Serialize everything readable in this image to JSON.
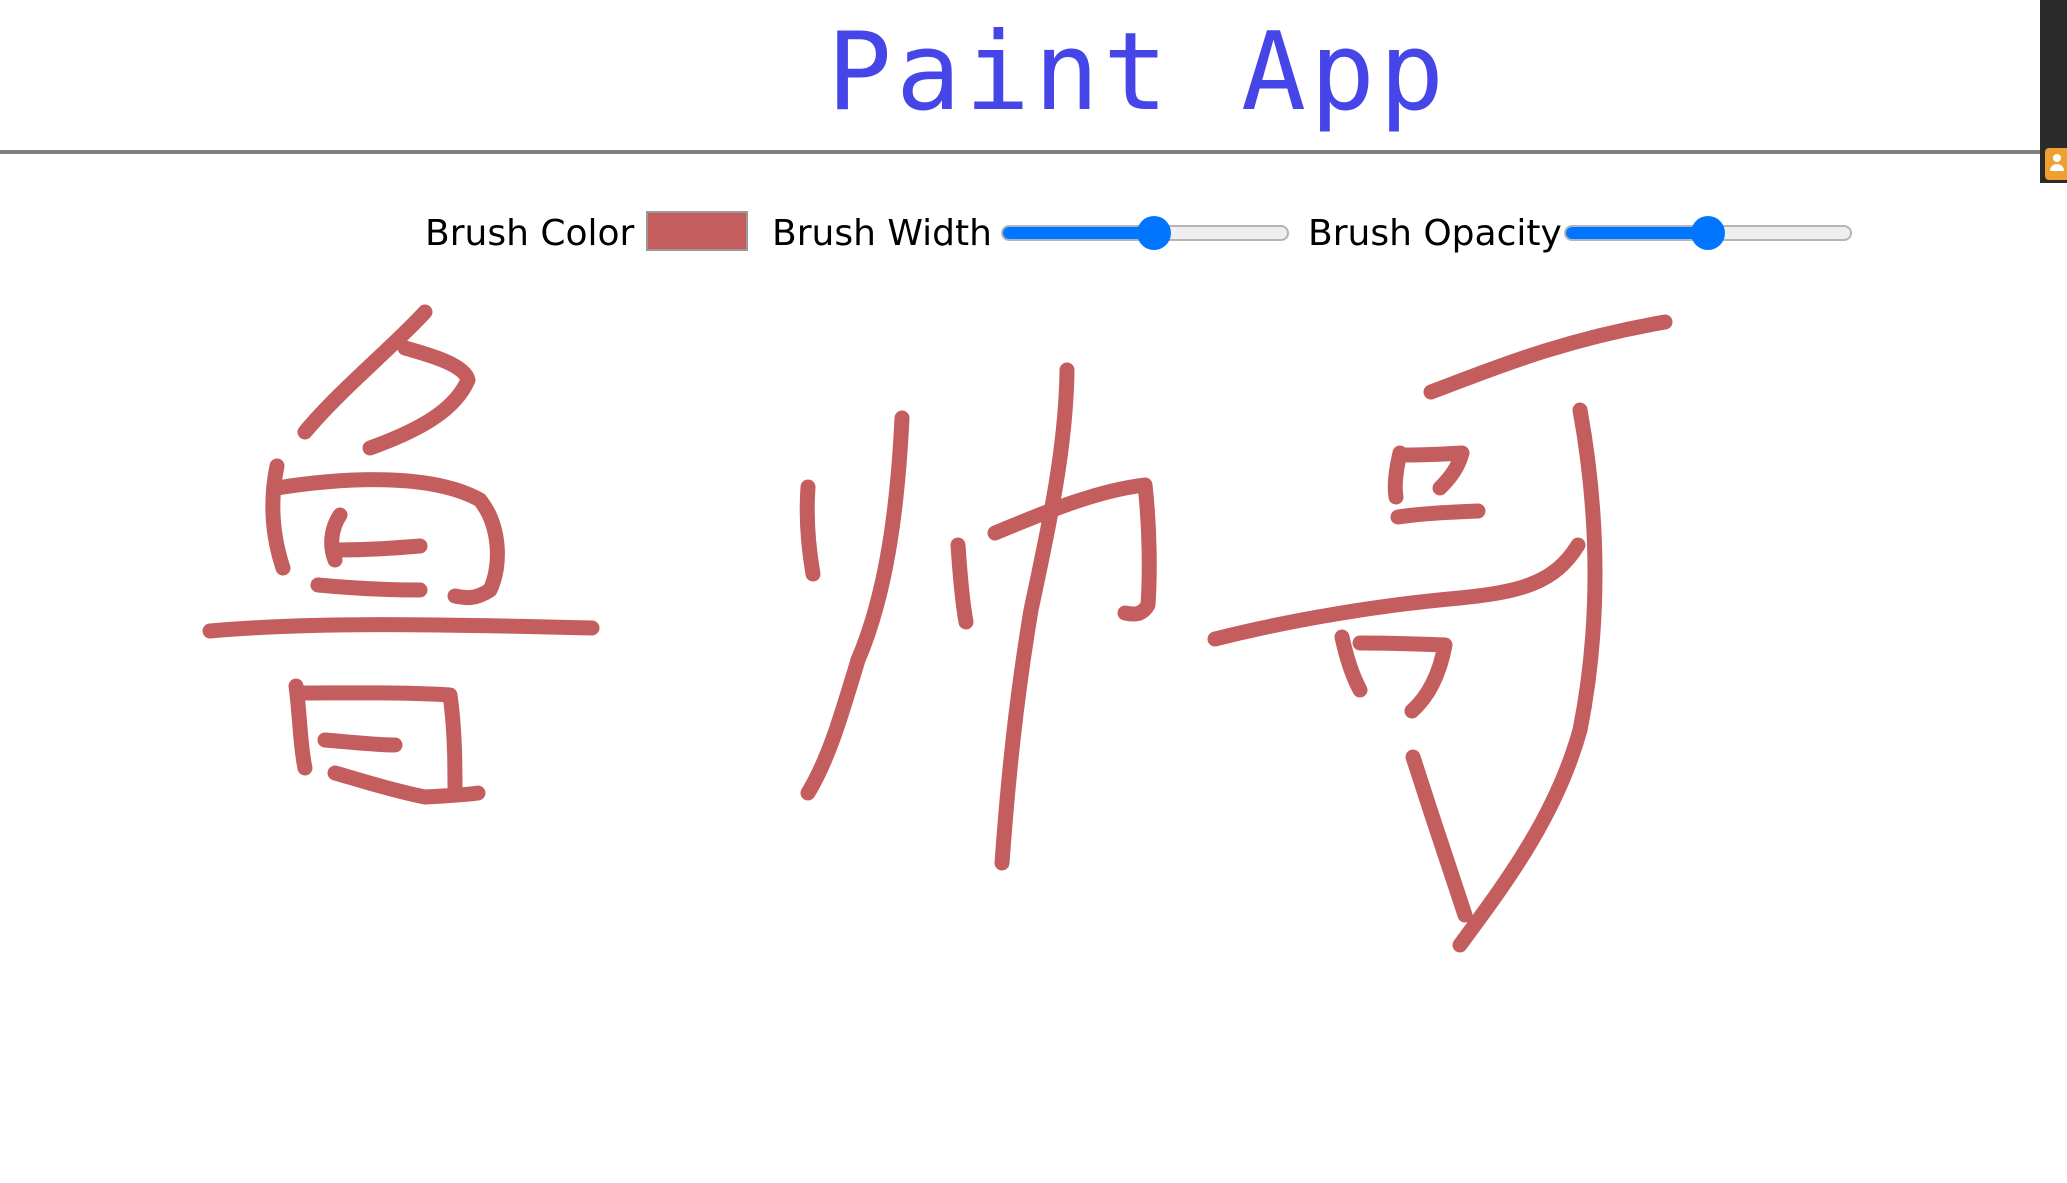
{
  "app": {
    "title": "Paint App",
    "title_color": "#4646e8"
  },
  "toolbar": {
    "brush_color_label": "Brush Color",
    "brush_color": "#c45e5e",
    "brush_width_label": "Brush Width",
    "brush_width_value": 0.53,
    "brush_opacity_label": "Brush Opacity",
    "brush_opacity_value": 0.5
  },
  "canvas": {
    "background": "#ffffff",
    "drawn_characters": [
      "鲁",
      "帅",
      "哥"
    ]
  }
}
